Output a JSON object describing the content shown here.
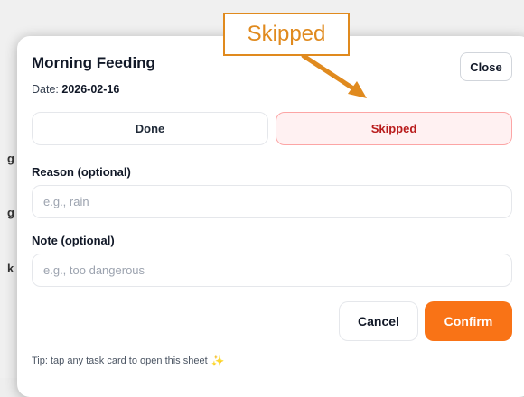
{
  "background": {
    "fragments": [
      "g",
      "g",
      "k"
    ]
  },
  "sheet": {
    "title": "Morning Feeding",
    "date_label": "Date:",
    "date_value": "2026-02-16",
    "close_label": "Close",
    "status_options": [
      {
        "label": "Done",
        "selected": false
      },
      {
        "label": "Skipped",
        "selected": true
      }
    ],
    "reason": {
      "label": "Reason (optional)",
      "value": "",
      "placeholder": "e.g., rain"
    },
    "note": {
      "label": "Note (optional)",
      "value": "",
      "placeholder": "e.g., too dangerous"
    },
    "cancel_label": "Cancel",
    "confirm_label": "Confirm",
    "tip": "Tip: tap any task card to open this sheet",
    "tip_icon": "sparkle-icon"
  },
  "annotation": {
    "label": "Skipped",
    "color": "#e08a1e"
  },
  "colors": {
    "accent": "#f97316",
    "selected_bg": "#fff1f2",
    "selected_border": "#fca5a5",
    "selected_text": "#b91c1c"
  }
}
